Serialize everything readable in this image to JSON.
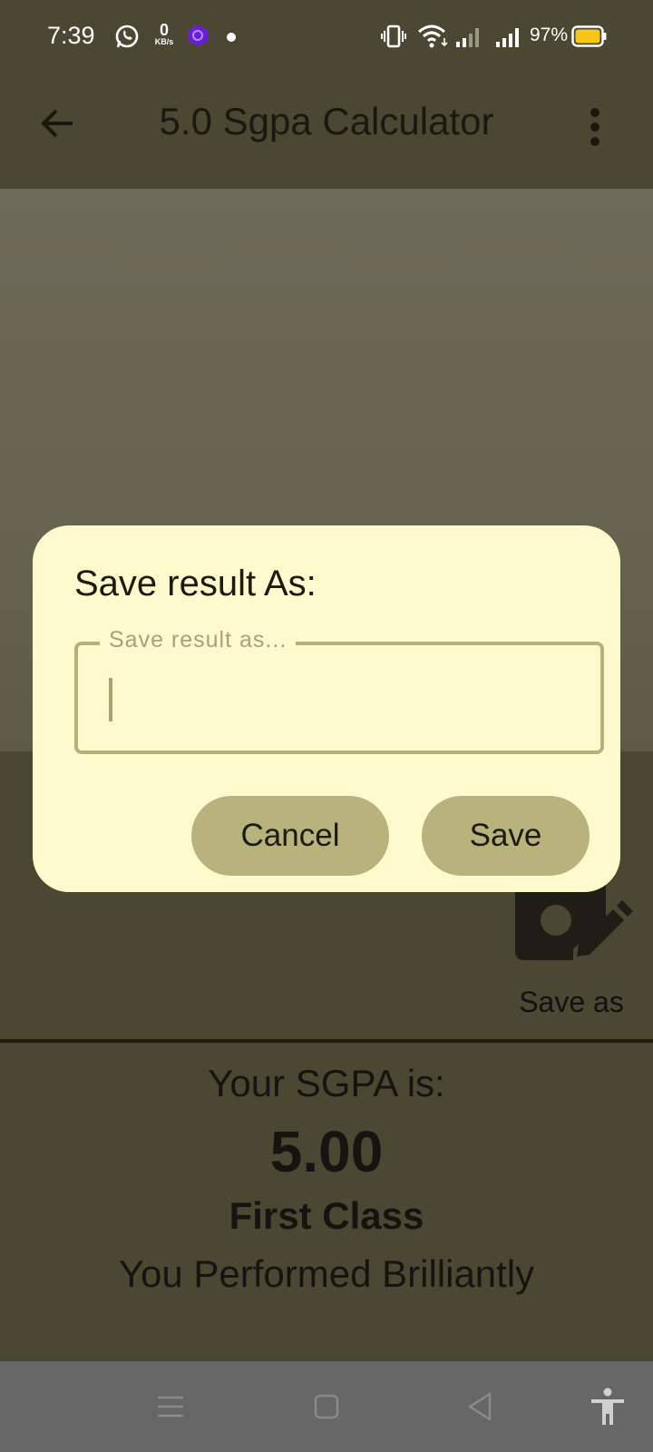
{
  "status_bar": {
    "time": "7:39",
    "net_speed_value": "0",
    "net_speed_unit": "KB/s",
    "battery_percent": "97%",
    "icons": [
      "whatsapp-icon",
      "net-speed-icon",
      "app-notification-icon",
      "dot-icon",
      "vibrate-icon",
      "wifi-icon",
      "signal-weak-icon",
      "signal-icon",
      "battery-icon"
    ],
    "battery_color": "#f5c518"
  },
  "app_bar": {
    "title": "5.0 Sgpa Calculator",
    "back_icon": "arrow-back-icon",
    "menu_icon": "more-vert-icon"
  },
  "actions": {
    "save_as_label": "Save as",
    "save_as_icon": "save-edit-icon"
  },
  "result": {
    "label": "Your SGPA is:",
    "value": "5.00",
    "class": "First Class",
    "message": "You Performed Brilliantly"
  },
  "dialog": {
    "title": "Save result As:",
    "field_label": "Save result  as...",
    "field_value": "",
    "cancel_label": "Cancel",
    "save_label": "Save"
  },
  "nav_bar": {
    "icons": [
      "menu-icon",
      "home-icon",
      "back-icon",
      "accessibility-icon"
    ]
  },
  "colors": {
    "background": "#4a4732",
    "dialog_bg": "#fefacd",
    "button_bg": "#b8b27c",
    "field_border": "#b6b07d"
  }
}
